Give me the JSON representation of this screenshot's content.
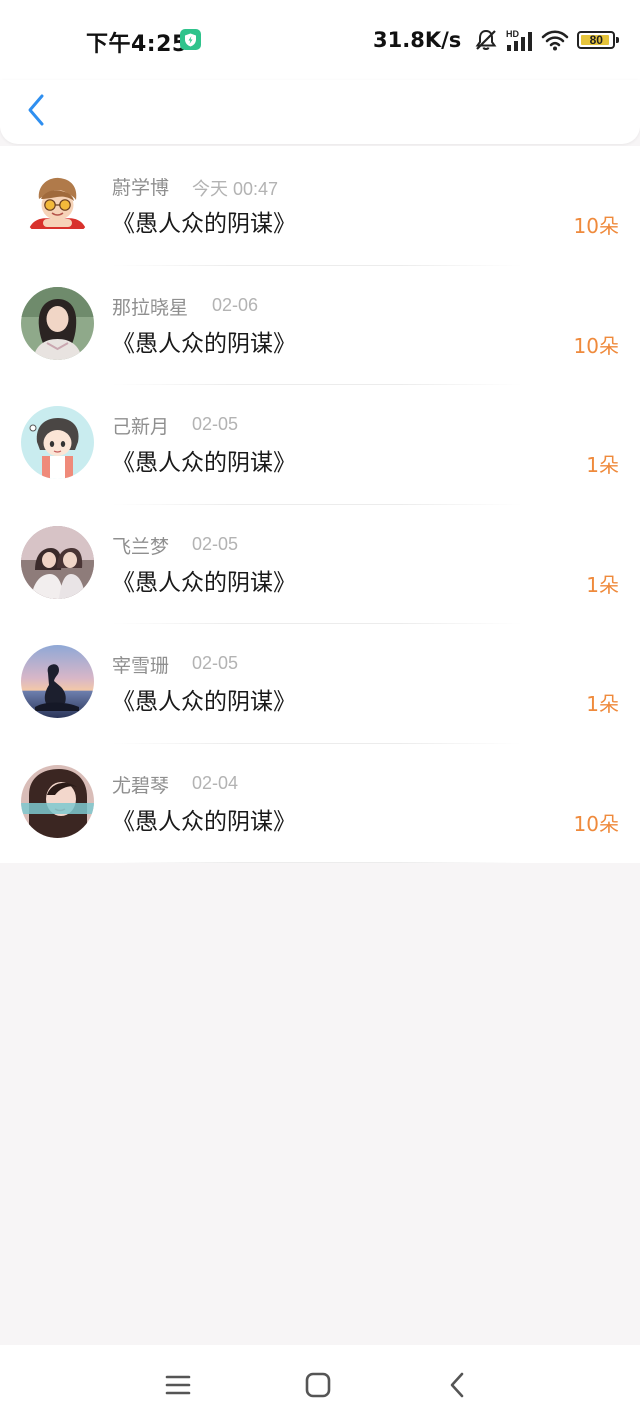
{
  "status_bar": {
    "time": "下午4:25",
    "net_speed": "31.8K/s",
    "battery": "80",
    "icons": [
      "shield-icon",
      "mute-bell-icon",
      "hd-signal-icon",
      "wifi-icon",
      "battery-icon"
    ]
  },
  "header": {
    "back_icon": "chevron-left-icon"
  },
  "records": [
    {
      "name": "蔚学博",
      "date": "今天 00:47",
      "title": "《愚人众的阴谋》",
      "amount": "10朵"
    },
    {
      "name": "那拉晓星",
      "date": "02-06",
      "title": "《愚人众的阴谋》",
      "amount": "10朵"
    },
    {
      "name": "己新月",
      "date": "02-05",
      "title": "《愚人众的阴谋》",
      "amount": "1朵"
    },
    {
      "name": "飞兰梦",
      "date": "02-05",
      "title": "《愚人众的阴谋》",
      "amount": "1朵"
    },
    {
      "name": "宰雪珊",
      "date": "02-05",
      "title": "《愚人众的阴谋》",
      "amount": "1朵"
    },
    {
      "name": "尤碧琴",
      "date": "02-04",
      "title": "《愚人众的阴谋》",
      "amount": "10朵"
    }
  ],
  "nav_bar": {
    "icons": [
      "menu-icon",
      "home-square-icon",
      "back-triangle-icon"
    ]
  },
  "colors": {
    "accent": "#ef8a3c",
    "name": "#8f8f8f",
    "date": "#b3b3b3",
    "title": "#1a1a1a",
    "back": "#2f8ff0",
    "background": "#f7f5f6"
  }
}
